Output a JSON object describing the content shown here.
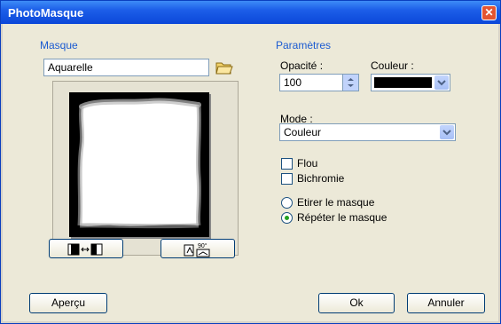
{
  "window": {
    "title": "PhotoMasque",
    "close_symbol": "✕"
  },
  "masque": {
    "section_title": "Masque",
    "name_value": "Aquarelle"
  },
  "parametres": {
    "section_title": "Paramètres",
    "opacite_label": "Opacité :",
    "opacite_value": "100",
    "couleur_label": "Couleur :",
    "couleur_value": "#000000",
    "mode_label": "Mode :",
    "mode_value": "Couleur",
    "flou_label": "Flou",
    "flou_checked": false,
    "bichromie_label": "Bichromie",
    "bichromie_checked": false,
    "etirer_label": "Etirer le masque",
    "repeter_label": "Répéter le masque",
    "selected_option": "repeter"
  },
  "rotate_label": "90°",
  "buttons": {
    "apercu": "Aperçu",
    "ok": "Ok",
    "annuler": "Annuler"
  }
}
